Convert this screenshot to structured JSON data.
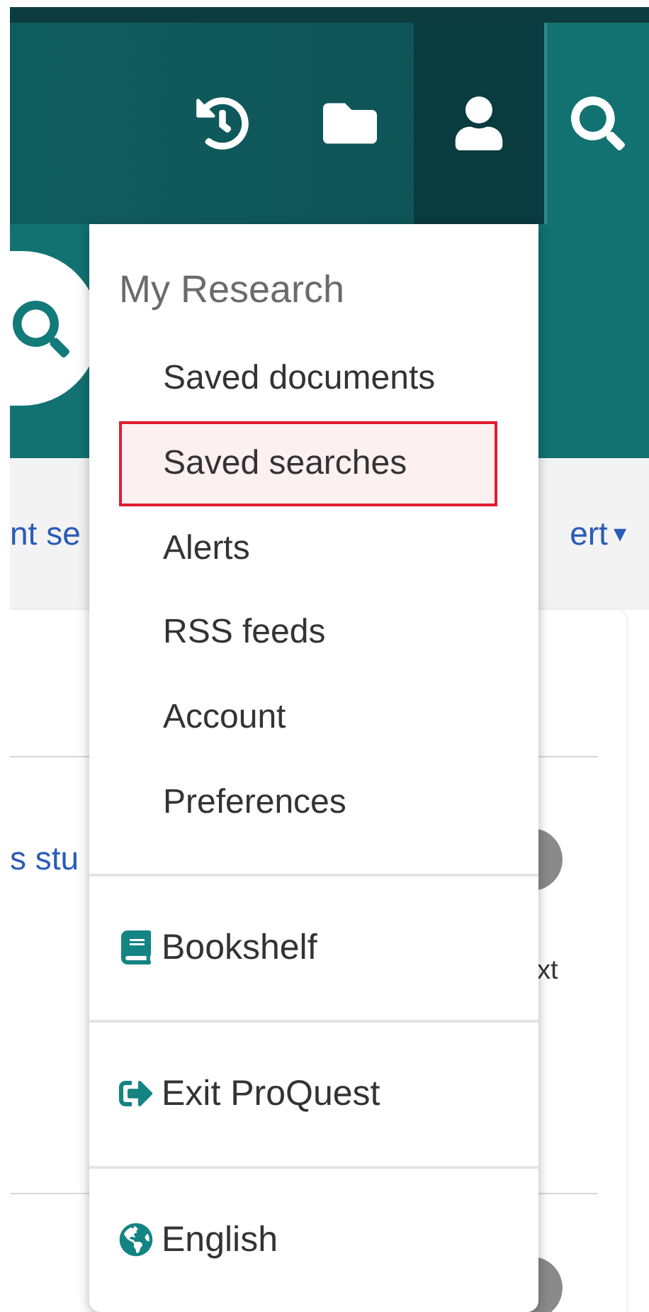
{
  "toolbar": {
    "buttons": [
      {
        "kind": "history",
        "selected": false
      },
      {
        "kind": "folder",
        "selected": false
      },
      {
        "kind": "user",
        "selected": true
      },
      {
        "kind": "search",
        "selected": false
      }
    ]
  },
  "search_band": {
    "button": {
      "kind": "search"
    }
  },
  "links_bar": {
    "left_link": "nt se",
    "right_link": "ert",
    "right_caret": "▾"
  },
  "results": [
    {
      "title": "s stu",
      "action": "xt"
    }
  ],
  "menu": {
    "heading": "My Research",
    "items": [
      {
        "label": "Saved documents",
        "selected": false
      },
      {
        "label": "Saved searches",
        "selected": true
      },
      {
        "label": "Alerts",
        "selected": false
      },
      {
        "label": "RSS feeds",
        "selected": false
      },
      {
        "label": "Account",
        "selected": false
      },
      {
        "label": "Preferences",
        "selected": false
      }
    ],
    "sections": [
      {
        "kind": "bookshelf",
        "label": "Bookshelf"
      },
      {
        "kind": "exit",
        "label": "Exit ProQuest"
      },
      {
        "kind": "language",
        "label": "English"
      }
    ]
  }
}
